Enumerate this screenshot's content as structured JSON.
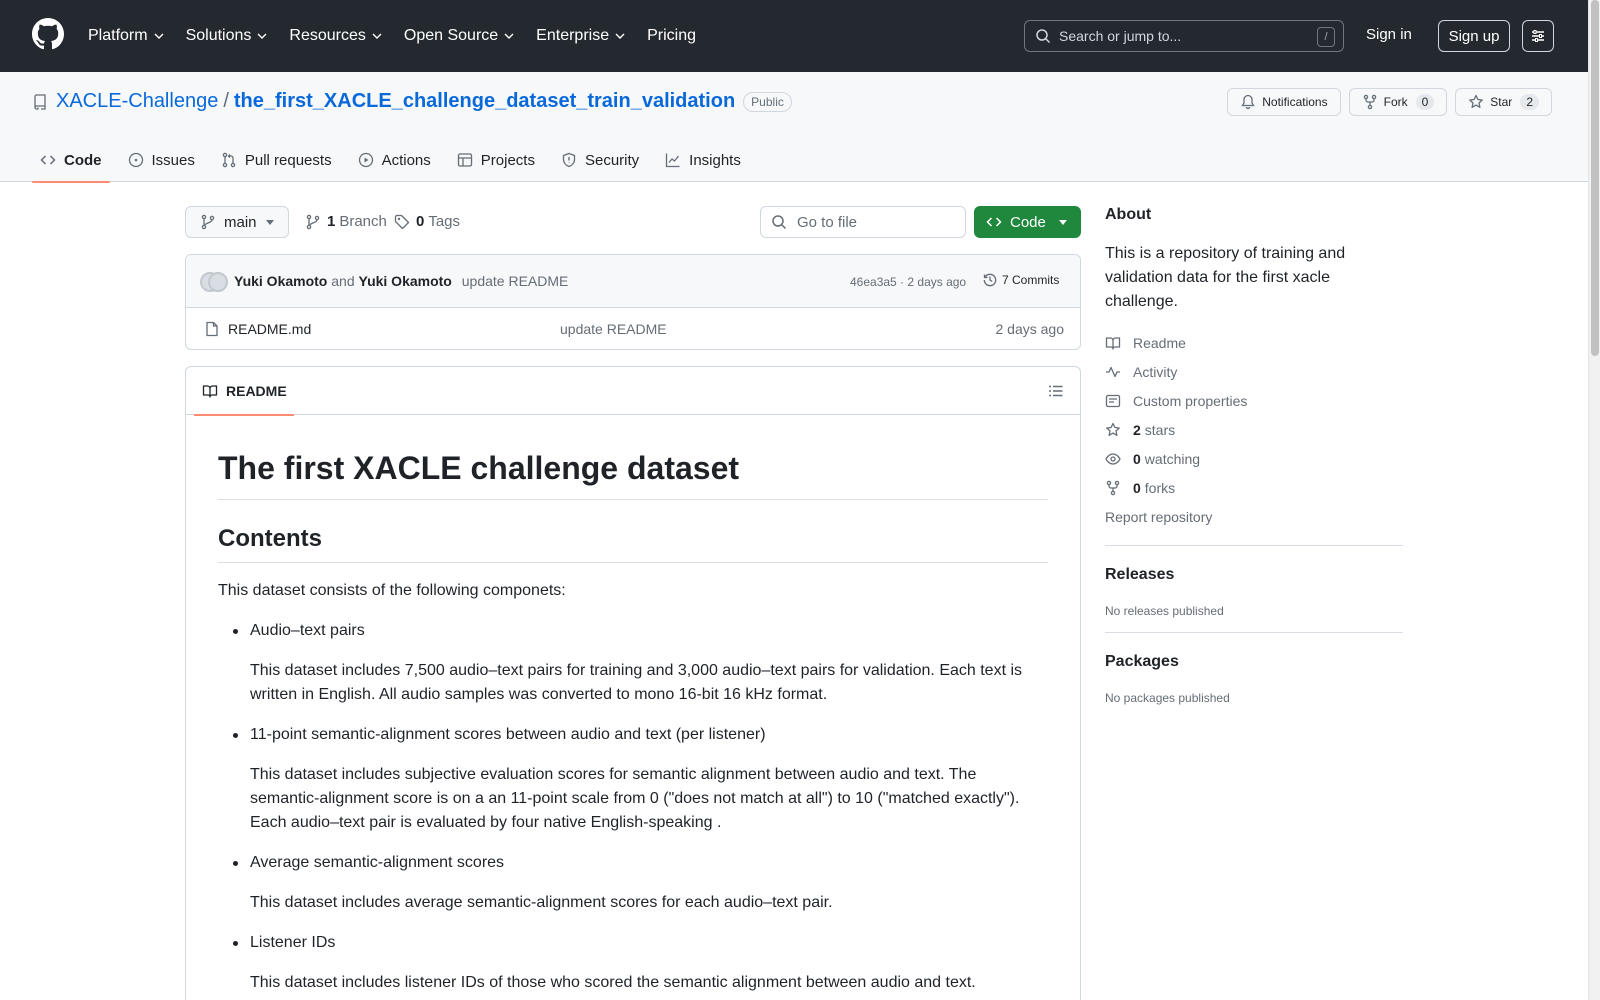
{
  "header": {
    "nav": [
      "Platform",
      "Solutions",
      "Resources",
      "Open Source",
      "Enterprise",
      "Pricing"
    ],
    "search_placeholder": "Search or jump to...",
    "search_shortcut": "/",
    "sign_in": "Sign in",
    "sign_up": "Sign up"
  },
  "repo": {
    "owner": "XACLE-Challenge",
    "separator": "/",
    "name": "the_first_XACLE_challenge_dataset_train_validation",
    "visibility": "Public",
    "notifications_label": "Notifications",
    "fork_label": "Fork",
    "fork_count": "0",
    "star_label": "Star",
    "star_count": "2",
    "tabs": [
      "Code",
      "Issues",
      "Pull requests",
      "Actions",
      "Projects",
      "Security",
      "Insights"
    ]
  },
  "toolbar": {
    "branch": "main",
    "branch_count": "1",
    "branch_label": "Branch",
    "tag_count": "0",
    "tag_label": "Tags",
    "goto_placeholder": "Go to file",
    "code_label": "Code"
  },
  "latest_commit": {
    "author1": "Yuki Okamoto",
    "and_text": "and",
    "author2": "Yuki Okamoto",
    "message": "update README",
    "hash_time": "46ea3a5 · 2 days ago",
    "commits_label": "7 Commits"
  },
  "files": [
    {
      "name": "README.md",
      "message": "update README",
      "age": "2 days ago"
    }
  ],
  "readme": {
    "tab_label": "README",
    "h1": "The first XACLE challenge dataset",
    "h2": "Contents",
    "intro": "This dataset consists of the following componets:",
    "items": [
      {
        "title": "Audio–text pairs",
        "desc": "This dataset includes 7,500 audio–text pairs for training and 3,000 audio–text pairs for validation. Each text is written in English. All audio samples was converted to mono 16-bit 16 kHz format."
      },
      {
        "title": "11-point semantic-alignment scores between audio and text (per listener)",
        "desc": "This dataset includes subjective evaluation scores for semantic alignment between audio and text. The semantic-alignment score is on a an 11-point scale from 0 (\"does not match at all\") to 10 (\"matched exactly\"). Each audio–text pair is evaluated by four native English-speaking ."
      },
      {
        "title": "Average semantic-alignment scores",
        "desc": "This dataset includes average semantic-alignment scores for each audio–text pair."
      },
      {
        "title": "Listener IDs",
        "desc": "This dataset includes listener IDs of those who scored the semantic alignment between audio and text."
      }
    ]
  },
  "sidebar": {
    "about_title": "About",
    "about_desc": "This is a repository of training and validation data for the first xacle challenge.",
    "readme": "Readme",
    "activity": "Activity",
    "custom_properties": "Custom properties",
    "stars_count": "2",
    "stars_label": "stars",
    "watching_count": "0",
    "watching_label": "watching",
    "forks_count": "0",
    "forks_label": "forks",
    "report": "Report repository",
    "releases_title": "Releases",
    "releases_note": "No releases published",
    "packages_title": "Packages",
    "packages_note": "No packages published"
  }
}
